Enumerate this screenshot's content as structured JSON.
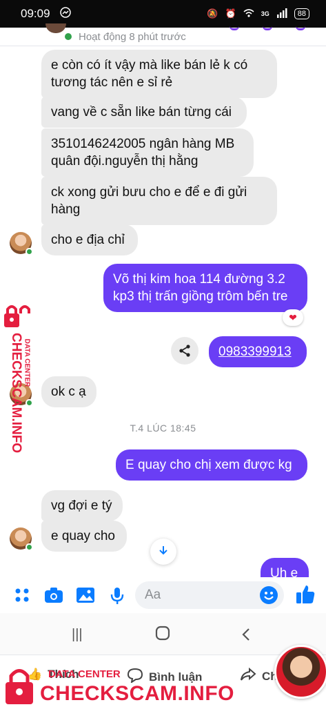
{
  "status_bar": {
    "time": "09:09",
    "network": "3G",
    "battery": "88"
  },
  "header": {
    "active_status": "Hoạt động 8 phút trước"
  },
  "messages": [
    {
      "side": "in",
      "text": "e còn có ít vậy mà like bán lẻ k có tương tác nên e sỉ rẻ"
    },
    {
      "side": "in",
      "text": "vang về c sẵn like bán từng cái"
    },
    {
      "side": "in",
      "text": "3510146242005 ngân hàng MB quân đội.nguyễn thị hằng"
    },
    {
      "side": "in",
      "text": "ck xong gửi bưu cho e để e đi gửi hàng"
    },
    {
      "side": "in",
      "text": "cho e địa chỉ"
    },
    {
      "side": "out",
      "text": "Võ thị kim hoa 114 đường 3.2 kp3 thị trấn giồng trôm bến tre"
    },
    {
      "side": "out",
      "text": "0983399913"
    },
    {
      "side": "in",
      "text": "ok c ạ"
    },
    {
      "side": "out",
      "text": "E quay cho chị xem được kg"
    },
    {
      "side": "in",
      "text": "vg đợi e tý"
    },
    {
      "side": "in",
      "text": "e quay cho"
    },
    {
      "side": "out",
      "text": "Uh e"
    }
  ],
  "timestamp": "T.4 LÚC 18:45",
  "composer": {
    "placeholder": "Aa"
  },
  "footer": {
    "like_label": "Thích",
    "comment_label": "Bình luận",
    "share_label": "Ch"
  },
  "watermark": {
    "main": "CHECKSCAM.INFO",
    "sub": "DATA CENTER"
  },
  "colors": {
    "outgoing": "#6a3ef5",
    "incoming": "#eaeaea",
    "messenger_blue": "#0a7cff",
    "watermark": "#e41e3f"
  },
  "icons": [
    "messenger-icon",
    "mute-icon",
    "alarm-icon",
    "wifi-icon",
    "signal-icon",
    "share-icon",
    "heart-icon",
    "menu-icon",
    "camera-icon",
    "image-icon",
    "microphone-icon",
    "emoji-icon",
    "thumbs-up-icon",
    "chevron-down-icon",
    "lock-icon",
    "comment-icon",
    "share-arrow-icon"
  ]
}
